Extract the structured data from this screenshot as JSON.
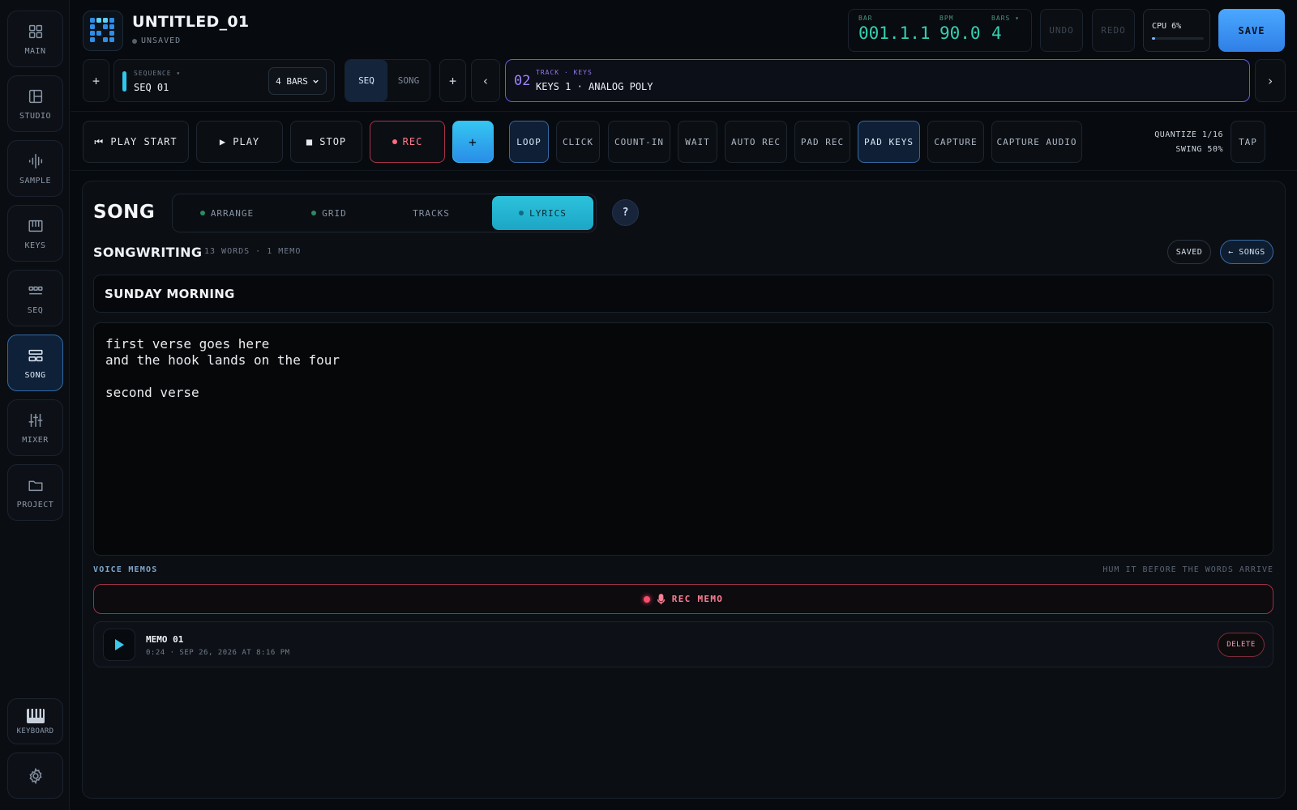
{
  "sidebar": {
    "items": [
      {
        "label": "MAIN",
        "icon": "grid-icon"
      },
      {
        "label": "STUDIO",
        "icon": "layout-icon"
      },
      {
        "label": "SAMPLE",
        "icon": "waveform-icon"
      },
      {
        "label": "KEYS",
        "icon": "piano-icon"
      },
      {
        "label": "SEQ",
        "icon": "sequencer-icon"
      },
      {
        "label": "SONG",
        "icon": "song-icon",
        "active": true
      },
      {
        "label": "MIXER",
        "icon": "sliders-icon"
      },
      {
        "label": "PROJECT",
        "icon": "folder-icon"
      }
    ],
    "keyboard_label": "KEYBOARD",
    "settings_icon": "gear-icon"
  },
  "header": {
    "title": "UNTITLED_01",
    "status": "UNSAVED",
    "bar_label": "BAR",
    "bar_value": "001.1.1",
    "bpm_label": "BPM",
    "bpm_value": "90.0",
    "bars_label": "BARS ▾",
    "bars_value": "4",
    "undo_label": "UNDO",
    "redo_label": "REDO",
    "cpu_label": "CPU 6%",
    "cpu_fraction": 0.06,
    "save_label": "SAVE"
  },
  "sequence_bar": {
    "add_label": "+",
    "sequence_key": "SEQUENCE ▾",
    "sequence_value": "SEQ 01",
    "bars_select": "4 BARS",
    "mode_seq": "SEQ",
    "mode_song": "SONG",
    "add_track_label": "+",
    "prev_label": "‹",
    "next_label": "›",
    "track_number": "02",
    "track_key": "TRACK · KEYS",
    "track_value": "KEYS 1 · ANALOG POLY"
  },
  "transport": {
    "play_start": "⏮ PLAY START",
    "play": "▶ PLAY",
    "stop": "■ STOP",
    "rec": "REC",
    "add": "+",
    "loop": "LOOP",
    "click": "CLICK",
    "count_in": "COUNT-IN",
    "wait": "WAIT",
    "auto_rec": "AUTO REC",
    "pad_rec": "PAD REC",
    "pad_keys": "PAD KEYS",
    "capture": "CAPTURE",
    "capture_audio": "CAPTURE AUDIO",
    "quantize": "QUANTIZE 1/16",
    "swing": "SWING 50%",
    "tap": "TAP"
  },
  "song": {
    "heading": "SONG",
    "tabs": [
      {
        "label": "ARRANGE",
        "dot": true
      },
      {
        "label": "GRID",
        "dot": true
      },
      {
        "label": "TRACKS",
        "dot": false
      },
      {
        "label": "LYRICS",
        "dot": true,
        "active": true
      }
    ],
    "help_label": "?",
    "songwriting_heading": "SONGWRITING",
    "songwriting_meta": "13 WORDS · 1 MEMO",
    "saved_label": "SAVED",
    "songs_label": "← SONGS",
    "song_title": "SUNDAY MORNING",
    "lyrics": "first verse goes here\nand the hook lands on the four\n\nsecond verse",
    "voice_memos_heading": "VOICE MEMOS",
    "voice_memos_hint": "HUM IT BEFORE THE WORDS ARRIVE",
    "rec_memo_label": "REC MEMO",
    "memos": [
      {
        "title": "MEMO 01",
        "meta": "0:24 · SEP 26, 2026 AT 8:16 PM",
        "delete_label": "DELETE"
      }
    ]
  },
  "colors": {
    "accent_blue": "#4aa8ff",
    "accent_cyan": "#2cc2dc",
    "readout_green": "#34d1b0",
    "track_purple": "#9f86ff",
    "rec_red": "#ff4c6a"
  }
}
